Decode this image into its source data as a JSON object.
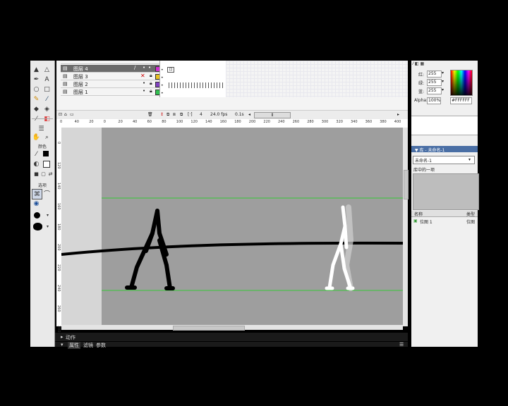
{
  "timeline": {
    "layers": [
      {
        "name": "图层 4",
        "selected": true
      },
      {
        "name": "图层 3",
        "selected": false
      },
      {
        "name": "图层 2",
        "selected": false
      },
      {
        "name": "图层 1",
        "selected": false
      }
    ],
    "frame_number": "4",
    "fps": "24.0 fps",
    "elapsed": "0.1s"
  },
  "ruler": {
    "top_ticks": [
      "0",
      "40",
      "20",
      "0",
      "20",
      "40",
      "60",
      "80",
      "100",
      "120",
      "140",
      "160",
      "180",
      "200",
      "220",
      "240",
      "260",
      "280",
      "300",
      "320",
      "340",
      "360",
      "380",
      "400"
    ],
    "left_ticks": [
      "0",
      "120",
      "140",
      "160",
      "180",
      "200",
      "220",
      "240",
      "260",
      "280"
    ]
  },
  "tools": {
    "color_label": "颜色",
    "options_label": "选项"
  },
  "color_mixer": {
    "red_label": "红:",
    "red_value": "255",
    "green_label": "绿:",
    "green_value": "255",
    "blue_label": "蓝:",
    "blue_value": "255",
    "alpha_label": "Alpha:",
    "alpha_value": "100%",
    "hex_value": "#FFFFFF"
  },
  "library": {
    "header": "▼ 库 - 未命名-1",
    "selector": "未命名-1",
    "item_count": "库中的一项",
    "col_name": "名称",
    "col_type": "类型",
    "row_name": "位图 1",
    "row_type": "位图"
  },
  "bottom": {
    "actions_label": "动作",
    "properties_tab": "属性",
    "filters_tab": "滤镜",
    "params_tab": "参数"
  },
  "colors": {
    "stage": "#9e9e9e",
    "pasteboard": "#d6d6d6",
    "guide": "#37c837",
    "playhead": "#dd0000"
  }
}
